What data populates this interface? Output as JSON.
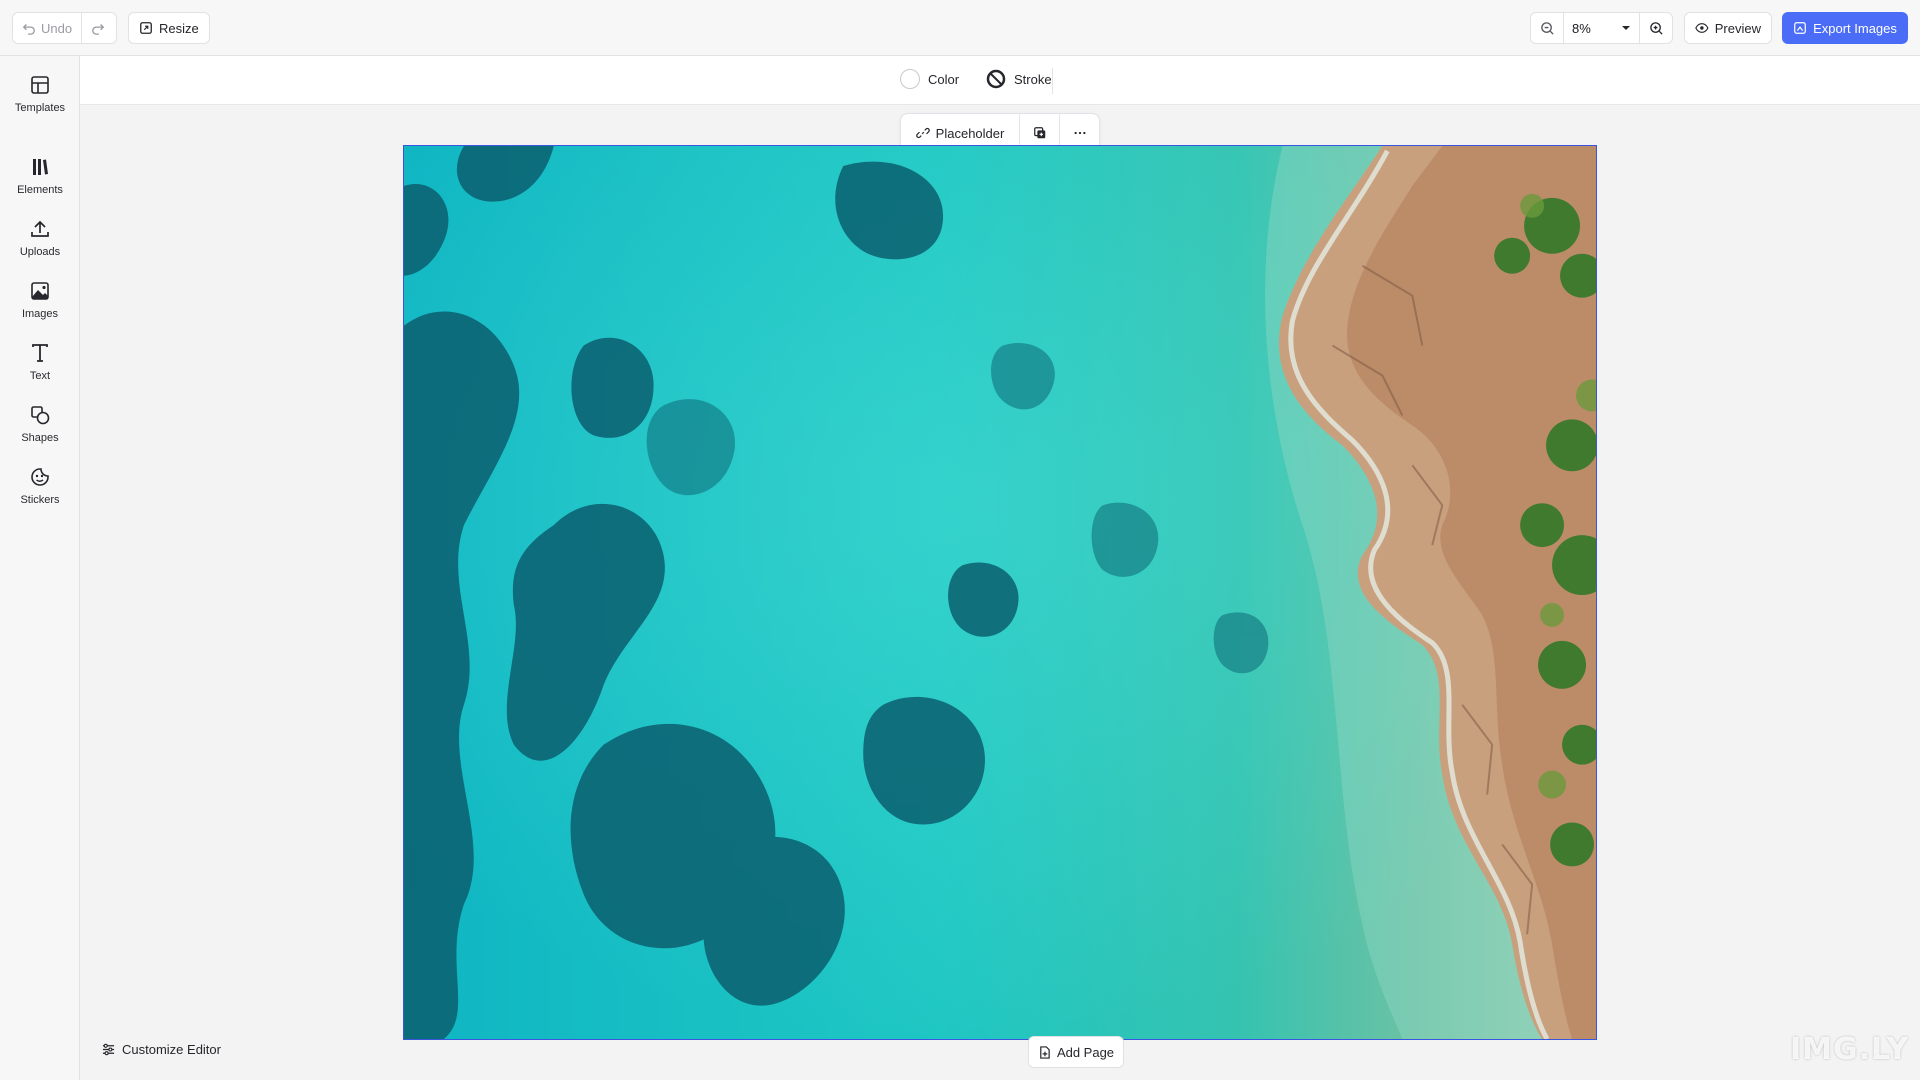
{
  "toolbar": {
    "undo_label": "Undo",
    "resize_label": "Resize",
    "zoom_value": "8%",
    "preview_label": "Preview",
    "export_label": "Export Images"
  },
  "sidebar": {
    "items": [
      {
        "label": "Templates",
        "icon": "templates-icon"
      },
      {
        "label": "Elements",
        "icon": "elements-icon"
      },
      {
        "label": "Uploads",
        "icon": "upload-icon"
      },
      {
        "label": "Images",
        "icon": "image-icon"
      },
      {
        "label": "Text",
        "icon": "text-icon"
      },
      {
        "label": "Shapes",
        "icon": "shapes-icon"
      },
      {
        "label": "Stickers",
        "icon": "sticker-icon"
      }
    ]
  },
  "subbar": {
    "color_label": "Color",
    "stroke_label": "Stroke"
  },
  "context_toolbar": {
    "placeholder_label": "Placeholder"
  },
  "footer": {
    "customize_label": "Customize Editor",
    "add_page_label": "Add Page",
    "watermark": "IMG.LY"
  },
  "colors": {
    "accent": "#4a6cf7",
    "selection": "#3a55e0",
    "water": "#1fc1c4",
    "rock": "#c99a76"
  }
}
